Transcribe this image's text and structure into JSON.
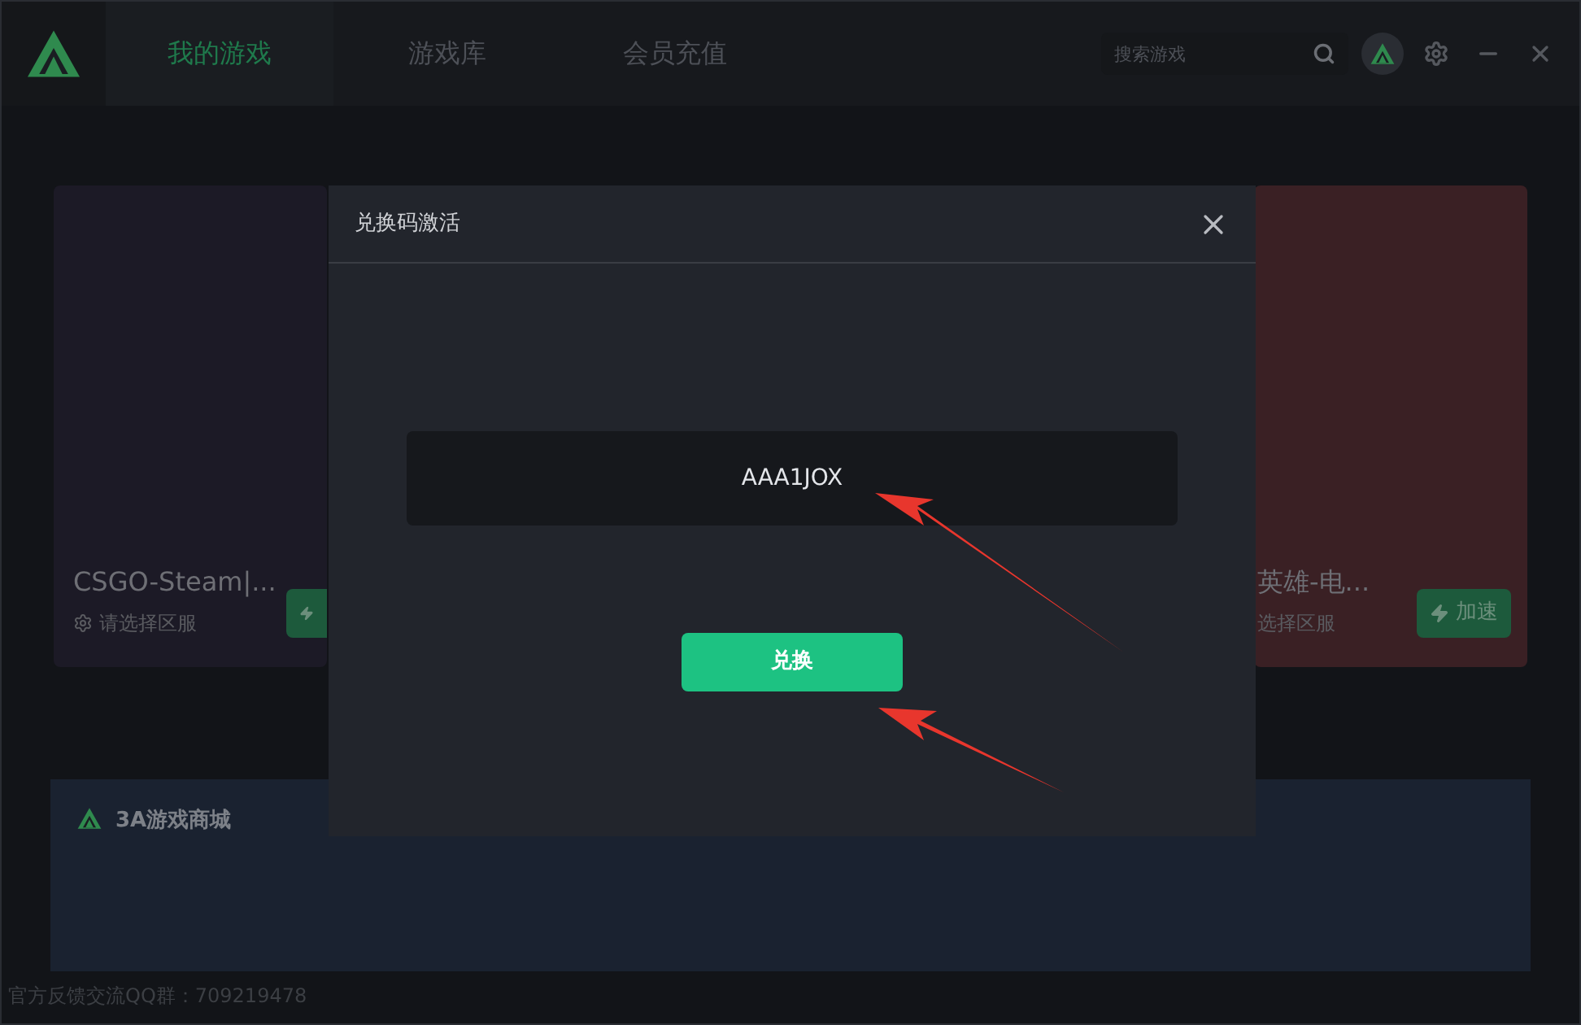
{
  "header": {
    "tabs": [
      {
        "label": "我的游戏",
        "selected": true
      },
      {
        "label": "游戏库",
        "selected": false
      },
      {
        "label": "会员充值",
        "selected": false
      }
    ],
    "search": {
      "placeholder": "搜索游戏"
    }
  },
  "games": [
    {
      "title": "CSGO-Steam|...",
      "region": "请选择区服"
    },
    {
      "title": "英雄-电...",
      "region": "选择区服",
      "button": "加速"
    }
  ],
  "banner": {
    "brand": "3A游戏商城"
  },
  "footer": "官方反馈交流QQ群：709219478",
  "dialog": {
    "title": "兑换码激活",
    "code": "AAA1JOX",
    "button": "兑换"
  }
}
